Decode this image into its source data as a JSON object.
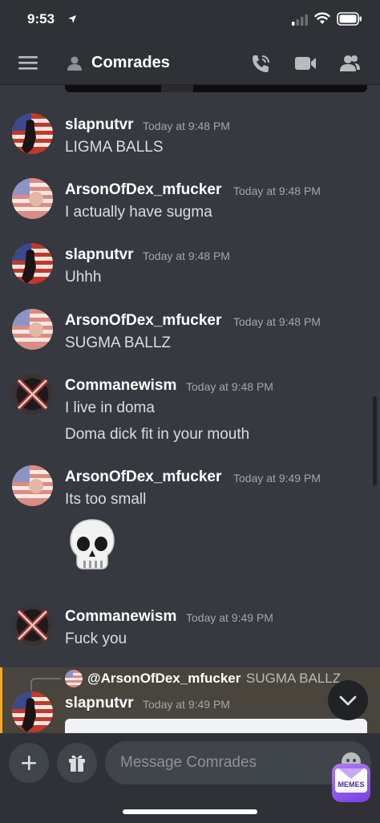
{
  "status_bar": {
    "time": "9:53",
    "icons": [
      "location-arrow-icon",
      "cellular-signal-icon",
      "wifi-icon",
      "battery-icon"
    ]
  },
  "header": {
    "title": "Comrades",
    "icons": [
      "hamburger-menu-icon",
      "group-dm-icon",
      "voice-call-icon",
      "video-call-icon",
      "members-icon"
    ]
  },
  "messages": [
    {
      "user": "slapnutvr",
      "time": "Today at 9:48 PM",
      "lines": [
        "LIGMA BALLS"
      ],
      "avatar": "flag-figure-avatar"
    },
    {
      "user": "ArsonOfDex_mfucker",
      "time": "Today at 9:48 PM",
      "lines": [
        "I actually have sugma"
      ],
      "avatar": "flag-avatar"
    },
    {
      "user": "slapnutvr",
      "time": "Today at 9:48 PM",
      "lines": [
        "Uhhh"
      ],
      "avatar": "flag-figure-avatar"
    },
    {
      "user": "ArsonOfDex_mfucker",
      "time": "Today at 9:48 PM",
      "lines": [
        "SUGMA BALLZ"
      ],
      "avatar": "flag-avatar"
    },
    {
      "user": "Commanewism",
      "time": "Today at 9:48 PM",
      "lines": [
        "I live in doma",
        "Doma dick fit in your mouth"
      ],
      "avatar": "dark-flag-avatar"
    },
    {
      "user": "ArsonOfDex_mfucker",
      "time": "Today at 9:49 PM",
      "lines": [
        "Its too small"
      ],
      "emoji": "💀",
      "avatar": "flag-avatar"
    },
    {
      "user": "Commanewism",
      "time": "Today at 9:49 PM",
      "lines": [
        "Fuck you"
      ],
      "avatar": "dark-flag-avatar"
    }
  ],
  "reply": {
    "mention": "@ArsonOfDex_mfucker",
    "preview": "SUGMA BALLZ",
    "user": "slapnutvr",
    "time": "Today at 9:49 PM"
  },
  "composer": {
    "placeholder": "Message Comrades",
    "app_badge": "MEMES"
  },
  "colors": {
    "background": "#36393f",
    "header": "#2f3136",
    "mention_highlight": "#49443c",
    "mention_bar": "#faa81a",
    "timestamp": "#a3a6aa"
  }
}
